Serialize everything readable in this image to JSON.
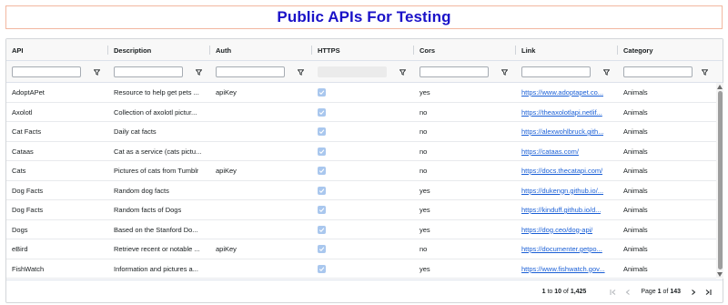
{
  "title": "Public APIs For Testing",
  "columns": [
    {
      "key": "api",
      "label": "API"
    },
    {
      "key": "description",
      "label": "Description"
    },
    {
      "key": "auth",
      "label": "Auth"
    },
    {
      "key": "https",
      "label": "HTTPS"
    },
    {
      "key": "cors",
      "label": "Cors"
    },
    {
      "key": "link",
      "label": "Link"
    },
    {
      "key": "category",
      "label": "Category"
    }
  ],
  "filters": {
    "api": "",
    "description": "",
    "auth": "",
    "cors": "",
    "link": "",
    "category": ""
  },
  "rows": [
    {
      "api": "AdoptAPet",
      "description": "Resource to help get pets ...",
      "auth": "apiKey",
      "https": true,
      "cors": "yes",
      "link": "https://www.adoptapet.co...",
      "category": "Animals"
    },
    {
      "api": "Axolotl",
      "description": "Collection of axolotl pictur...",
      "auth": "",
      "https": true,
      "cors": "no",
      "link": "https://theaxolotlapi.netlif...",
      "category": "Animals"
    },
    {
      "api": "Cat Facts",
      "description": "Daily cat facts",
      "auth": "",
      "https": true,
      "cors": "no",
      "link": "https://alexwohlbruck.gith...",
      "category": "Animals"
    },
    {
      "api": "Cataas",
      "description": "Cat as a service (cats pictu...",
      "auth": "",
      "https": true,
      "cors": "no",
      "link": "https://cataas.com/",
      "category": "Animals"
    },
    {
      "api": "Cats",
      "description": "Pictures of cats from Tumblr",
      "auth": "apiKey",
      "https": true,
      "cors": "no",
      "link": "https://docs.thecatapi.com/",
      "category": "Animals"
    },
    {
      "api": "Dog Facts",
      "description": "Random dog facts",
      "auth": "",
      "https": true,
      "cors": "yes",
      "link": "https://dukengn.github.io/...",
      "category": "Animals"
    },
    {
      "api": "Dog Facts",
      "description": "Random facts of Dogs",
      "auth": "",
      "https": true,
      "cors": "yes",
      "link": "https://kinduff.github.io/d...",
      "category": "Animals"
    },
    {
      "api": "Dogs",
      "description": "Based on the Stanford Do...",
      "auth": "",
      "https": true,
      "cors": "yes",
      "link": "https://dog.ceo/dog-api/",
      "category": "Animals"
    },
    {
      "api": "eBird",
      "description": "Retrieve recent or notable ...",
      "auth": "apiKey",
      "https": true,
      "cors": "no",
      "link": "https://documenter.getpo...",
      "category": "Animals"
    },
    {
      "api": "FishWatch",
      "description": "Information and pictures a...",
      "auth": "",
      "https": true,
      "cors": "yes",
      "link": "https://www.fishwatch.gov...",
      "category": "Animals"
    }
  ],
  "pagination": {
    "from": "1",
    "to_word": "to",
    "to": "10",
    "of_word": "of",
    "total": "1,425",
    "page_word": "Page",
    "page": "1",
    "page_of_word": "of",
    "page_total": "143"
  },
  "colors": {
    "title": "#1a12c8",
    "title_border": "#f2b7a0",
    "link": "#1a5fd6",
    "checkbox": "#a9c7ee"
  },
  "icons": [
    "filter-icon",
    "check-icon",
    "first-page-icon",
    "prev-page-icon",
    "next-page-icon",
    "last-page-icon",
    "scroll-up-icon",
    "scroll-down-icon"
  ]
}
